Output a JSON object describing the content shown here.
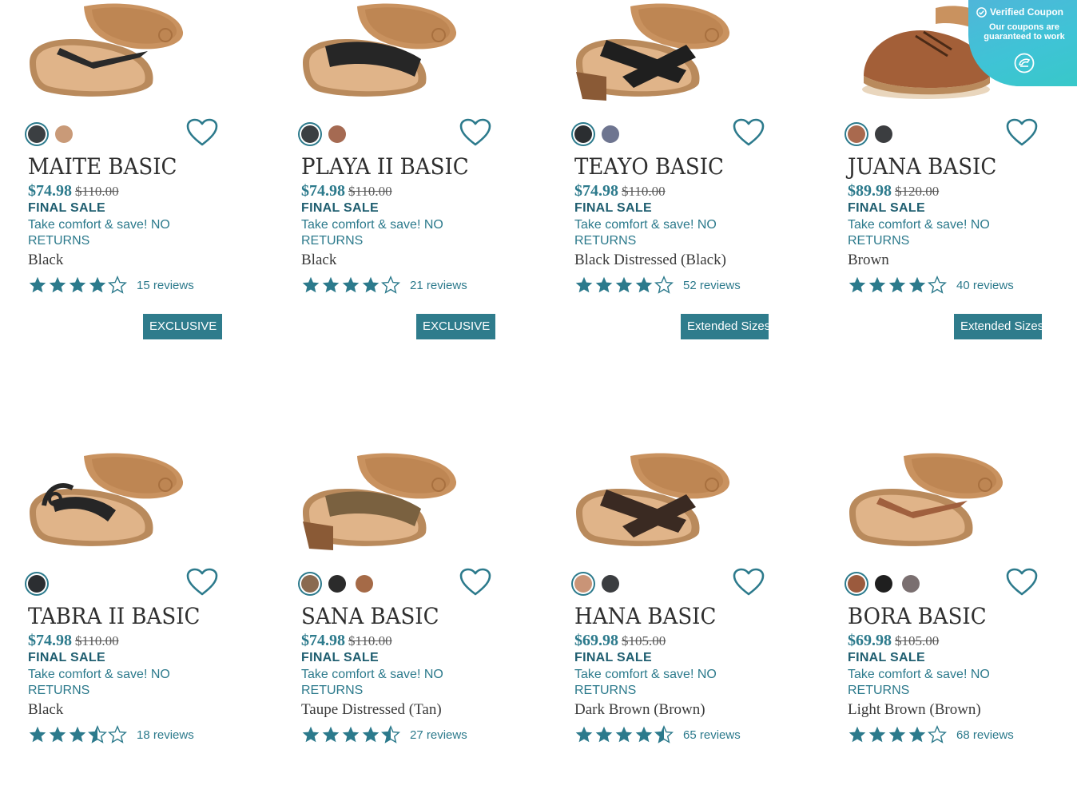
{
  "colors": {
    "accent": "#2c7a8c",
    "badge": "#2f7c8c",
    "text": "#2f2f2f"
  },
  "coupon": {
    "title": "Verified Coupon",
    "subtitle": "Our coupons are guaranteed to work",
    "icon": "coupon-logo-icon"
  },
  "products": [
    {
      "name": "MAITE BASIC",
      "price": "$74.98",
      "was": "$110.00",
      "final": "FINAL SALE",
      "promo": "Take comfort & save! NO RETURNS",
      "color": "Black",
      "rating": 4,
      "reviews": "15 reviews",
      "badge": "EXCLUSIVE",
      "swatches": [
        "#3b3f42",
        "#c99a78"
      ],
      "shoe": "flip-flop",
      "shoe_color": "#2a2a2a"
    },
    {
      "name": "PLAYA II BASIC",
      "price": "$74.98",
      "was": "$110.00",
      "final": "FINAL SALE",
      "promo": "Take comfort & save! NO RETURNS",
      "color": "Black",
      "rating": 4,
      "reviews": "21 reviews",
      "badge": "EXCLUSIVE",
      "swatches": [
        "#3b3f42",
        "#a56a52"
      ],
      "shoe": "slide",
      "shoe_color": "#262626"
    },
    {
      "name": "TEAYO BASIC",
      "price": "$74.98",
      "was": "$110.00",
      "final": "FINAL SALE",
      "promo": "Take comfort & save! NO RETURNS",
      "color": "Black Distressed (Black)",
      "rating": 4,
      "reviews": "52 reviews",
      "badge": "Extended Sizes",
      "swatches": [
        "#2b2e31",
        "#6e7590"
      ],
      "shoe": "cross-wedge",
      "shoe_color": "#1f1f1f"
    },
    {
      "name": "JUANA BASIC",
      "price": "$89.98",
      "was": "$120.00",
      "final": "FINAL SALE",
      "promo": "Take comfort & save! NO RETURNS",
      "color": "Brown",
      "rating": 4,
      "reviews": "40 reviews",
      "badge": "Extended Sizes",
      "swatches": [
        "#a9694e",
        "#3b3d40"
      ],
      "shoe": "oxford",
      "shoe_color": "#a35f38"
    },
    {
      "name": "TABRA II BASIC",
      "price": "$74.98",
      "was": "$110.00",
      "final": "FINAL SALE",
      "promo": "Take comfort & save! NO RETURNS",
      "color": "Black",
      "rating": 3.5,
      "reviews": "18 reviews",
      "badge": "",
      "swatches": [
        "#2b2e31"
      ],
      "shoe": "sandal",
      "shoe_color": "#262626"
    },
    {
      "name": "SANA BASIC",
      "price": "$74.98",
      "was": "$110.00",
      "final": "FINAL SALE",
      "promo": "Take comfort & save! NO RETURNS",
      "color": "Taupe Distressed (Tan)",
      "rating": 4.5,
      "reviews": "27 reviews",
      "badge": "",
      "swatches": [
        "#8a6a50",
        "#2b2b2b",
        "#a56a47"
      ],
      "shoe": "slide-wedge",
      "shoe_color": "#7a6140"
    },
    {
      "name": "HANA BASIC",
      "price": "$69.98",
      "was": "$105.00",
      "final": "FINAL SALE",
      "promo": "Take comfort & save! NO RETURNS",
      "color": "Dark Brown (Brown)",
      "rating": 4.5,
      "reviews": "65 reviews",
      "badge": "",
      "swatches": [
        "#c99477",
        "#3b3d40"
      ],
      "shoe": "cross-slide",
      "shoe_color": "#3a2a22"
    },
    {
      "name": "BORA BASIC",
      "price": "$69.98",
      "was": "$105.00",
      "final": "FINAL SALE",
      "promo": "Take comfort & save! NO RETURNS",
      "color": "Light Brown (Brown)",
      "rating": 4,
      "reviews": "68 reviews",
      "badge": "",
      "swatches": [
        "#9b5a3d",
        "#1f1f1f",
        "#7a6f70"
      ],
      "shoe": "thong",
      "shoe_color": "#a0603e"
    }
  ]
}
